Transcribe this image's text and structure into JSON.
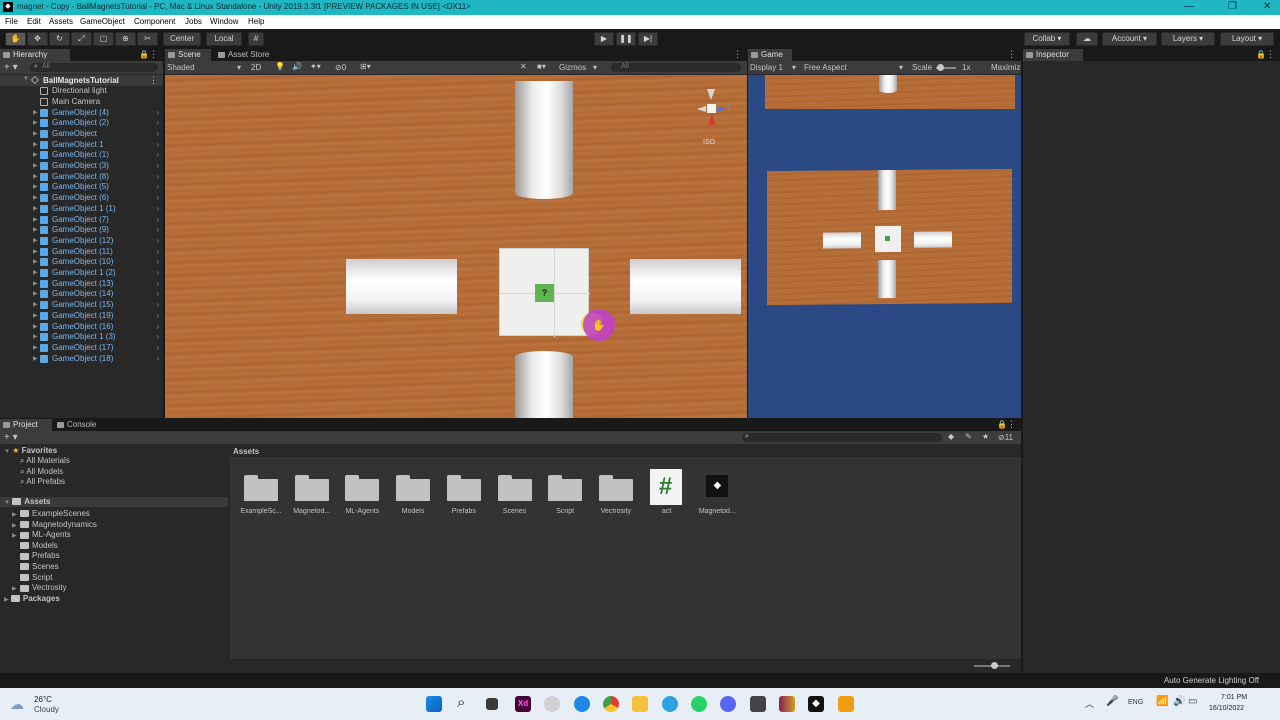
{
  "window": {
    "title": "magnet - Copy - BallMagnetsTutorial - PC, Mac & Linux Standalone - Unity 2019.3.3f1 [PREVIEW PACKAGES IN USE] <DX11>",
    "logo": "unity-logo-icon",
    "controls": [
      "—",
      "❐",
      "✕"
    ]
  },
  "menu": [
    "File",
    "Edit",
    "Assets",
    "GameObject",
    "Component",
    "Jobs",
    "Window",
    "Help"
  ],
  "toolbar": {
    "pivot": "Center",
    "space": "Local",
    "collab": "Collab ▾",
    "account": "Account",
    "layers": "Layers",
    "layout": "Layout"
  },
  "hierarchy": {
    "tab": "Hierarchy",
    "search_placeholder": "All",
    "scene_name": "BallMagnetsTutorial",
    "static_items": [
      "Directional light",
      "Main Camera"
    ],
    "items": [
      "GameObject (4)",
      "GameObject (2)",
      "GameObject",
      "GameObject 1",
      "GameObject (1)",
      "GameObject (3)",
      "GameObject (8)",
      "GameObject (5)",
      "GameObject (6)",
      "GameObject 1 (1)",
      "GameObject (7)",
      "GameObject (9)",
      "GameObject (12)",
      "GameObject (11)",
      "GameObject (10)",
      "GameObject 1 (2)",
      "GameObject (13)",
      "GameObject (14)",
      "GameObject (15)",
      "GameObject (19)",
      "GameObject (16)",
      "GameObject 1 (3)",
      "GameObject (17)",
      "GameObject (18)"
    ]
  },
  "scene": {
    "tab": "Scene",
    "asset_store_tab": "Asset Store",
    "draw_mode": "Shaded",
    "mode_2d": "2D",
    "hidden_count": "0",
    "gizmos": "Gizmos",
    "search_placeholder": "All",
    "orientation_label": "ISO",
    "axis_x": "x",
    "axis_z": "z",
    "cube_glyph": "?"
  },
  "game": {
    "tab": "Game",
    "display": "Display 1",
    "aspect": "Free Aspect",
    "scale_label": "Scale",
    "scale_value": "1x",
    "maximize": "Maximiz"
  },
  "inspector": {
    "tab": "Inspector"
  },
  "project": {
    "tab": "Project",
    "console_tab": "Console",
    "favorites": {
      "label": "Favorites",
      "items": [
        "All Materials",
        "All Models",
        "All Prefabs"
      ]
    },
    "assets_root": "Assets",
    "asset_tree": [
      "ExampleScenes",
      "Magnetodynamics",
      "ML-Agents",
      "Models",
      "Prefabs",
      "Scenes",
      "Script",
      "Vectrosity"
    ],
    "packages": "Packages",
    "breadcrumb": "Assets",
    "badge_count": "11",
    "grid": [
      "ExampleSc...",
      "Magnetod...",
      "ML-Agents",
      "Models",
      "Prefabs",
      "Scenes",
      "Script",
      "Vectrosity",
      "act",
      "Magnetod..."
    ],
    "script_glyph": "#"
  },
  "status": {
    "text": "Auto Generate Lighting Off"
  },
  "taskbar": {
    "weather_temp": "26°C",
    "weather_desc": "Cloudy",
    "lang": "ENG",
    "time": "7:01 PM",
    "date": "16/10/2022"
  },
  "colors": {
    "title_bar": "#20b7c5",
    "editor_bg": "#282828",
    "hierarchy_item": "#78b7f0",
    "scene_floor": "#b56b34",
    "game_bg": "#2b4a85",
    "cursor_highlight": "#c040d0"
  }
}
